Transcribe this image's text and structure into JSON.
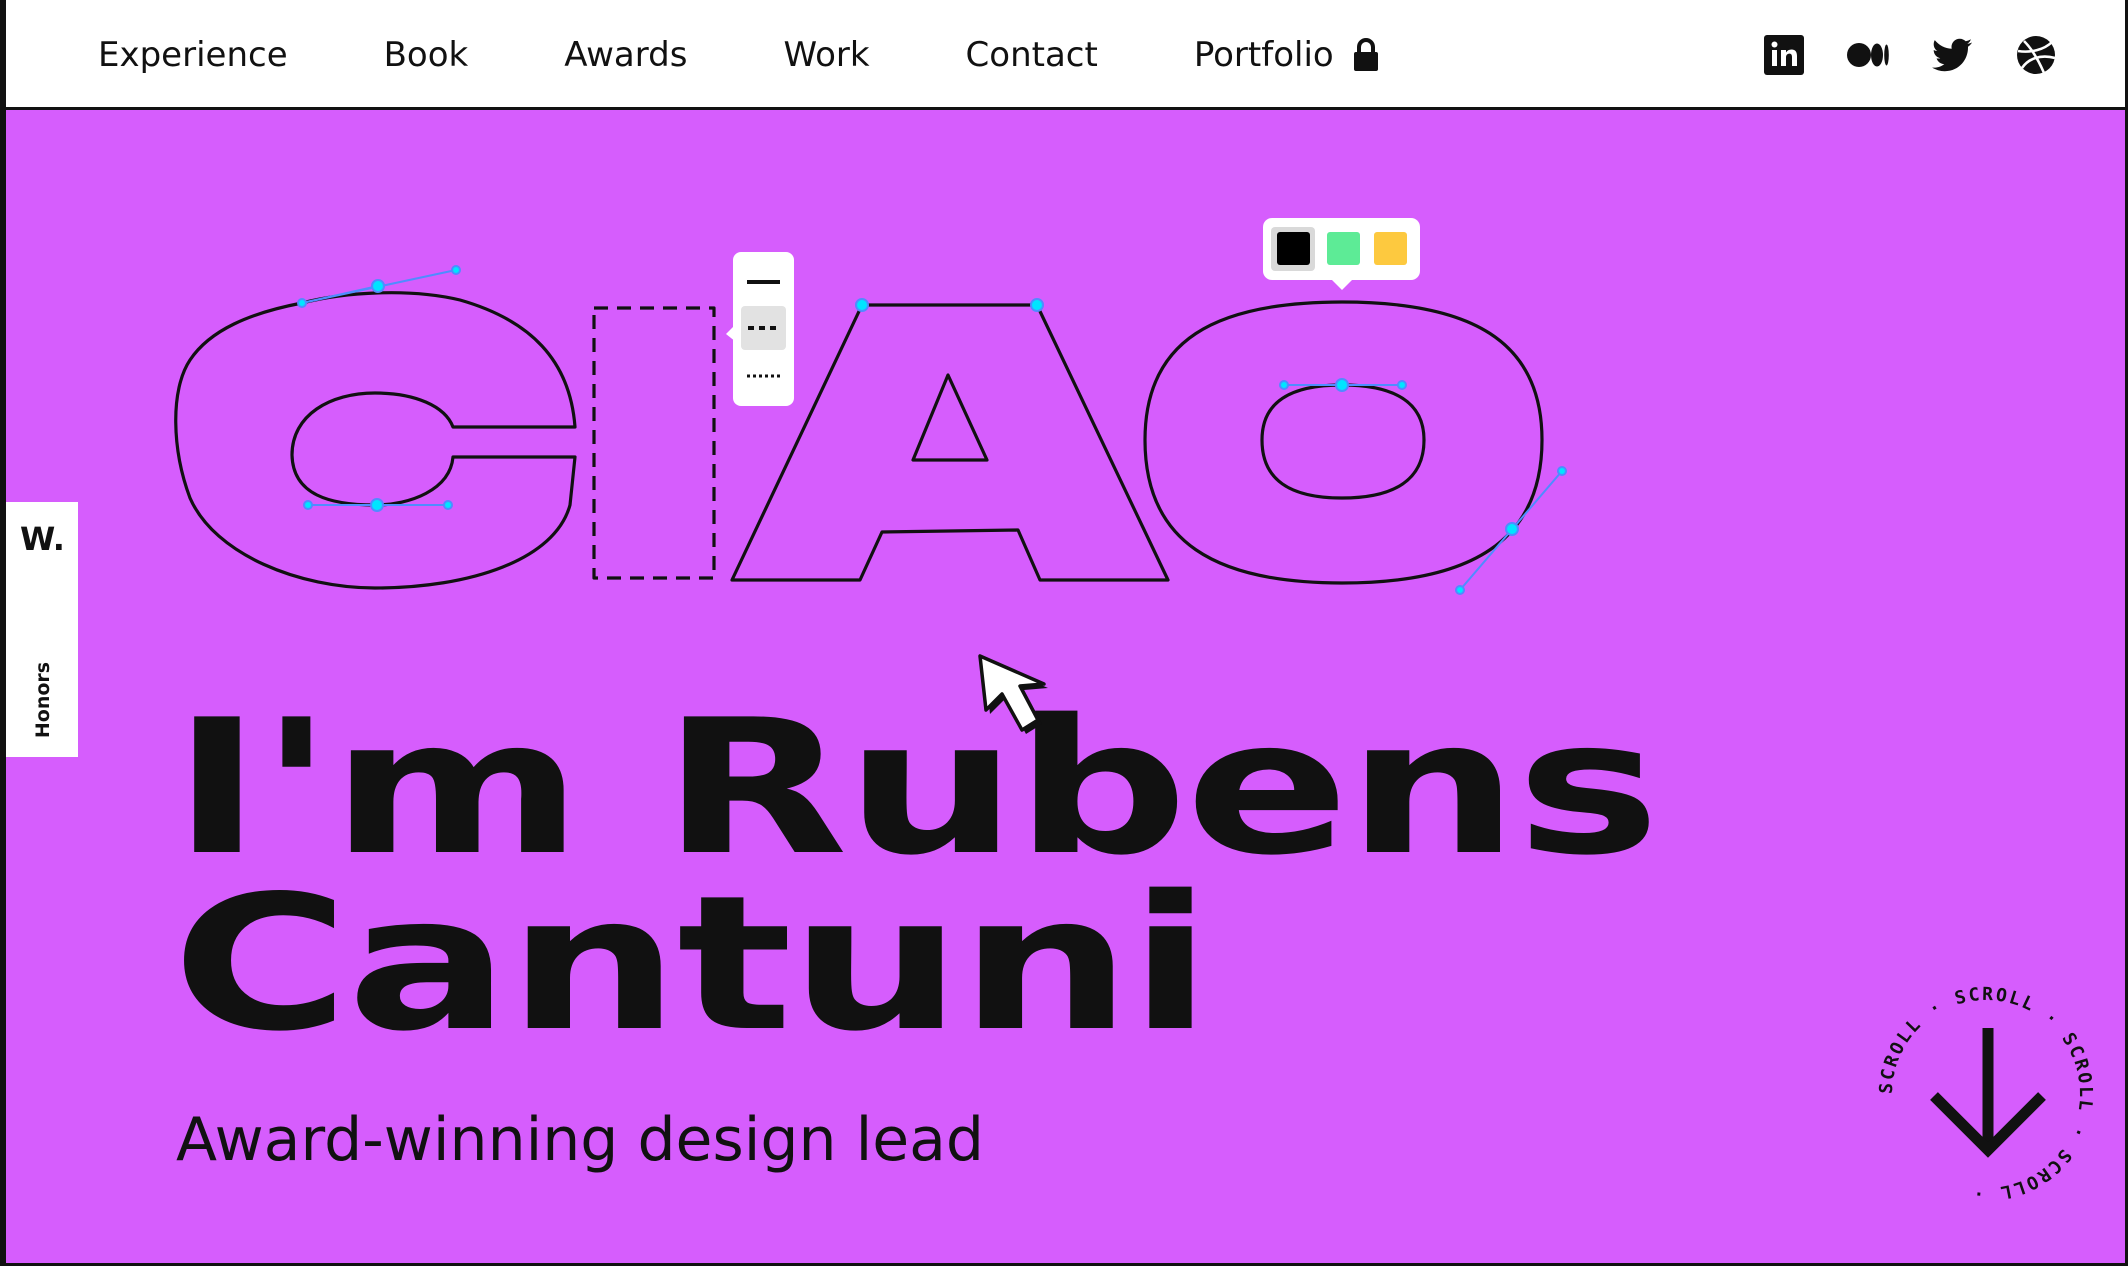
{
  "nav": {
    "items": [
      {
        "label": "Experience"
      },
      {
        "label": "Book"
      },
      {
        "label": "Awards"
      },
      {
        "label": "Work"
      },
      {
        "label": "Contact"
      },
      {
        "label": "Portfolio",
        "icon": "lock-icon"
      }
    ]
  },
  "social": [
    {
      "icon": "linkedin-icon"
    },
    {
      "icon": "medium-icon"
    },
    {
      "icon": "twitter-icon"
    },
    {
      "icon": "dribbble-icon"
    }
  ],
  "side_tab": {
    "logo": "W.",
    "label": "Honors"
  },
  "hero": {
    "art_word": "CIAO",
    "swatches": [
      "#000000",
      "#5deb96",
      "#fdc93f"
    ],
    "stroke_options": [
      "solid",
      "dashed",
      "dotted"
    ],
    "selected_stroke": "dashed",
    "headline_line1": "I'm Rubens",
    "headline_line2": "Cantuni",
    "tagline": "Award-winning design lead"
  },
  "scroll": {
    "text": "SCROLL · SCROLL · SCROLL · SCROLL · "
  },
  "colors": {
    "background": "#d65dfd",
    "header": "#ffffff",
    "ink": "#111111",
    "handle": "#00e5ff",
    "handle_line": "#4f8cff"
  }
}
